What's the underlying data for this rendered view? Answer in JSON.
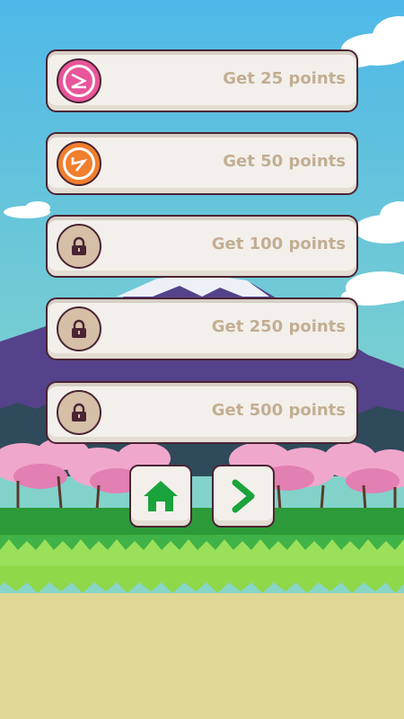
{
  "achievements": [
    {
      "label": "Get 25 points",
      "status": "unlocked",
      "color": "#e8559a",
      "icon": "zigzag-z-icon"
    },
    {
      "label": "Get 50 points",
      "status": "unlocked",
      "color": "#f07f2e",
      "icon": "zigzag-s-icon"
    },
    {
      "label": "Get 100 points",
      "status": "locked",
      "color": "#d5bfa7",
      "icon": "lock-icon"
    },
    {
      "label": "Get 250 points",
      "status": "locked",
      "color": "#d5bfa7",
      "icon": "lock-icon"
    },
    {
      "label": "Get 500 points",
      "status": "locked",
      "color": "#d5bfa7",
      "icon": "lock-icon"
    }
  ],
  "buttons": {
    "home": {
      "icon": "home-icon",
      "color": "#1aa33c"
    },
    "next": {
      "icon": "chevron-right-icon",
      "color": "#1aa33c"
    }
  }
}
